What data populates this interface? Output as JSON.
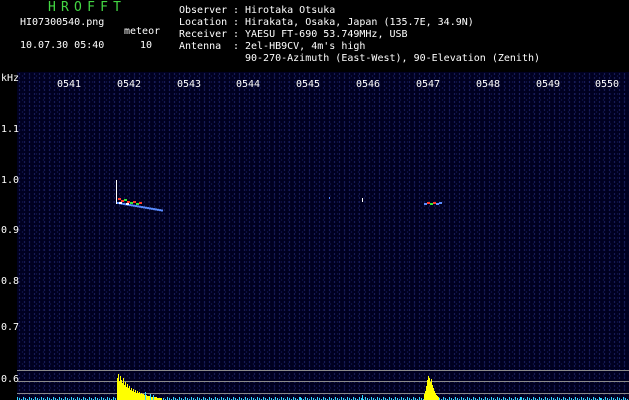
{
  "logo": "HROFFT",
  "file": {
    "name": "HI07300540.png",
    "datetime": "10.07.30 05:40",
    "meteor_label": "meteor",
    "meteor_count": "10"
  },
  "station": {
    "observer_label": "Observer",
    "observer": "Hirotaka Otsuka",
    "location_label": "Location",
    "location": "Hirakata, Osaka, Japan (135.7E, 34.9N)",
    "receiver_label": "Receiver",
    "receiver": "YAESU FT-690 53.749MHz, USB",
    "antenna_label": "Antenna",
    "antenna_line1": "2el-HB9CV, 4m's high",
    "antenna_line2": "90-270-Azimuth (East-West), 90-Elevation (Zenith)",
    "separator": ":"
  },
  "y_unit": "kHz",
  "x_ticks": [
    "0541",
    "0542",
    "0543",
    "0544",
    "0545",
    "0546",
    "0547",
    "0548",
    "0549",
    "0550"
  ],
  "y_ticks": [
    "1.1",
    "1.0",
    "0.9",
    "0.8",
    "0.7",
    "0.6"
  ],
  "colors": {
    "logo": "#43d743",
    "text": "#ffffff",
    "plot_background": "#000020",
    "noise_dot": "#3c46aa",
    "echo_blue": "#5a8cff",
    "echo_red": "#ff3a2a",
    "echo_green": "#32e632",
    "echo_white": "#ffffff",
    "bar_yellow": "#ffff00",
    "bar_cyan": "#2fd8ff",
    "gridline": "#8a8a8a"
  }
}
